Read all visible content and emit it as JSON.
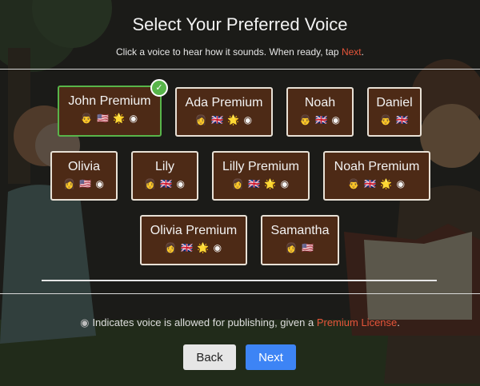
{
  "header": {
    "title": "Select Your Preferred Voice",
    "subtitle_prefix": "Click a voice to hear how it sounds. When ready, tap ",
    "subtitle_link": "Next",
    "subtitle_suffix": "."
  },
  "voices": [
    {
      "name": "John Premium",
      "badges": "👨 🇺🇸 🌟",
      "selected": true
    },
    {
      "name": "Ada Premium",
      "badges": "👩 🇬🇧 🌟",
      "selected": false
    },
    {
      "name": "Noah",
      "badges": "👨 🇬🇧",
      "selected": false
    },
    {
      "name": "Daniel",
      "badges": "👨 🇬🇧",
      "selected": false
    },
    {
      "name": "Olivia",
      "badges": "👩 🇺🇸",
      "selected": false
    },
    {
      "name": "Lily",
      "badges": "👩 🇬🇧",
      "selected": false
    },
    {
      "name": "Lilly Premium",
      "badges": "👩 🇬🇧 🌟",
      "selected": false
    },
    {
      "name": "Noah Premium",
      "badges": "👨 🇬🇧 🌟",
      "selected": false
    },
    {
      "name": "Olivia Premium",
      "badges": "👩 🇬🇧 🌟",
      "selected": false
    },
    {
      "name": "Samantha",
      "badges": "👩 🇺🇸",
      "selected": false
    }
  ],
  "publish_icon": "publish-signal-icon",
  "publish_glyph": "◉",
  "check_glyph": "✓",
  "note": {
    "prefix": "Indicates voice is allowed for publishing, given a ",
    "link": "Premium License",
    "suffix": "."
  },
  "buttons": {
    "back": "Back",
    "next": "Next"
  },
  "colors": {
    "accent_link": "#e5553a",
    "card_bg": "#4d2a16",
    "selected_border": "#58b54a",
    "next_button": "#3d84f5"
  }
}
